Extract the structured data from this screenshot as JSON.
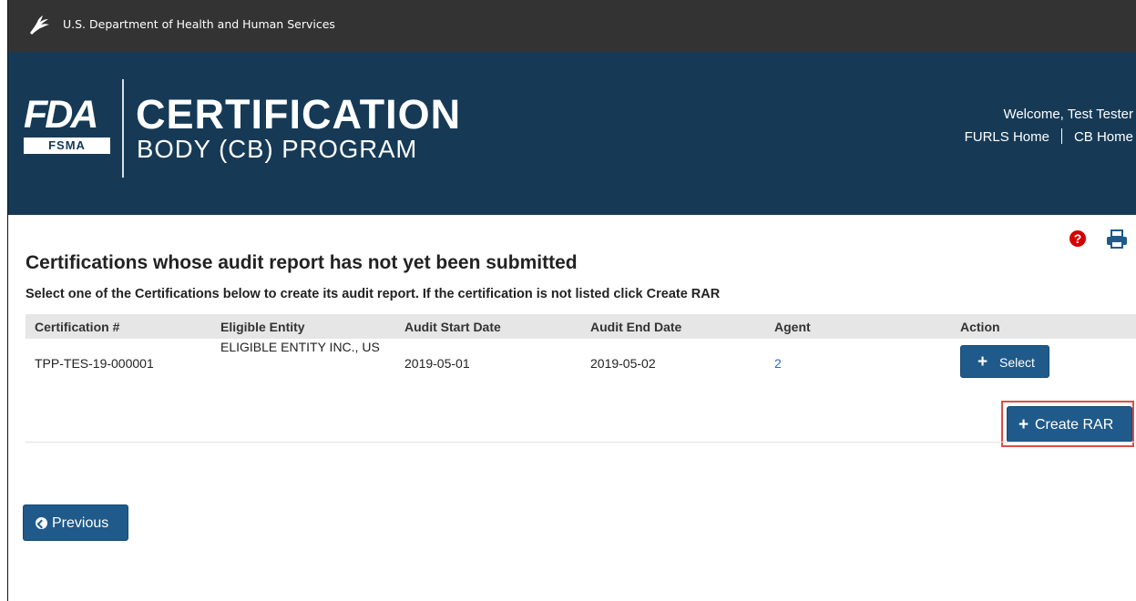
{
  "hhs_bar": {
    "text": "U.S. Department of Health and Human Services",
    "icon": "hhs-eagle-icon"
  },
  "banner": {
    "fda_letters": "FDA",
    "fsma": "FSMA",
    "title_line1": "CERTIFICATION",
    "title_line2": "BODY (CB) PROGRAM",
    "welcome": "Welcome, Test Tester",
    "link_furls": "FURLS Home",
    "link_cb": "CB Home"
  },
  "icons": {
    "help": "?",
    "print": "print-icon"
  },
  "page": {
    "heading": "Certifications whose audit report has not yet been submitted",
    "instructions": "Select one of the Certifications below to create its audit report. If the certification is not listed click Create RAR"
  },
  "grid": {
    "columns": [
      "Certification #",
      "Eligible Entity",
      "Audit Start Date",
      "Audit End Date",
      "Agent",
      "Action"
    ],
    "rows": [
      {
        "certification": "TPP-TES-19-000001",
        "entity": "ELIGIBLE ENTITY INC., US",
        "start": "2019-05-01",
        "end": "2019-05-02",
        "agent": "2",
        "action": "Select"
      }
    ]
  },
  "buttons": {
    "create_rar": "Create RAR",
    "previous": "Previous",
    "plus": "+"
  },
  "colors": {
    "banner": "#163a56",
    "topbar": "#333333",
    "button": "#1f5a8a",
    "highlight": "#e04a4a"
  }
}
